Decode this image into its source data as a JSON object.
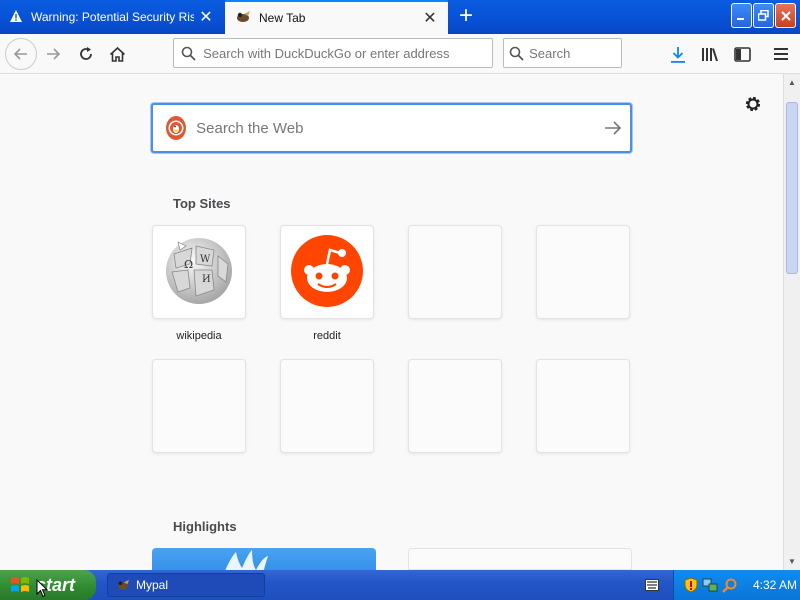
{
  "tabs": [
    {
      "label": "Warning: Potential Security Risk A",
      "active": false,
      "icon": "warning-icon"
    },
    {
      "label": "New Tab",
      "active": true,
      "icon": "mypal-icon"
    }
  ],
  "navbar": {
    "url_placeholder": "Search with DuckDuckGo or enter address",
    "search_placeholder": "Search"
  },
  "content": {
    "web_search_placeholder": "Search the Web",
    "top_sites_title": "Top Sites",
    "highlights_title": "Highlights",
    "top_sites": [
      {
        "label": "wikipedia",
        "icon": "wikipedia-icon"
      },
      {
        "label": "reddit",
        "icon": "reddit-icon"
      }
    ]
  },
  "taskbar": {
    "start_label": "start",
    "task_item_label": "Mypal",
    "clock": "4:32 AM"
  },
  "colors": {
    "titlebar": "#0853d8",
    "accent": "#0a84ff",
    "reddit": "#ff4500",
    "duckduckgo": "#de5833",
    "taskbar": "#2456c7",
    "start_button": "#2f8a2f"
  }
}
